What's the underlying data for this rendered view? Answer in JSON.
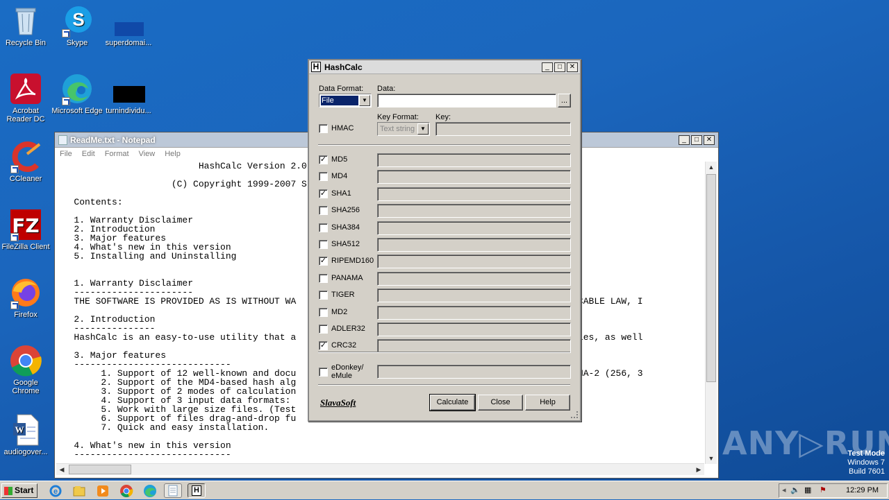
{
  "desktop": {
    "icons": [
      {
        "label": "Recycle Bin"
      },
      {
        "label": "Skype"
      },
      {
        "label": "superdomai..."
      },
      {
        "label": "Acrobat Reader DC"
      },
      {
        "label": "Microsoft Edge"
      },
      {
        "label": "turnindividu..."
      },
      {
        "label": "CCleaner"
      },
      {
        "label": "FileZilla Client"
      },
      {
        "label": "Firefox"
      },
      {
        "label": "Google Chrome"
      },
      {
        "label": "audiogover..."
      }
    ],
    "watermark": "ANY▷RUN",
    "test_mode": {
      "line1": "Test Mode",
      "line2": "Windows 7",
      "line3": "Build 7601"
    }
  },
  "notepad": {
    "title": "ReadMe.txt - Notepad",
    "menu": [
      "File",
      "Edit",
      "Format",
      "View",
      "Help"
    ],
    "lines": [
      "                          HashCalc Version 2.0",
      "",
      "                     (C) Copyright 1999-2007 S",
      "",
      "   Contents:",
      "",
      "   1. Warranty Disclaimer",
      "   2. Introduction",
      "   3. Major features",
      "   4. What's new in this version",
      "   5. Installing and Uninstalling",
      "",
      "",
      "   1. Warranty Disclaimer",
      "   ----------------------",
      "   THE SOFTWARE IS PROVIDED AS IS WITHOUT WA                                         ED BY APPLICABLE LAW, I",
      "",
      "   2. Introduction",
      "   ---------------",
      "   HashCalc is an easy-to-use utility that a                                         MACs for files, as well",
      "",
      "   3. Major features",
      "   -----------------------------",
      "        1. Support of 12 well-known and docu                                         5, SHA-1, SHA-2 (256, 3",
      "        2. Support of the MD4-based hash alg                                        ule, etc.);",
      "        3. Support of 2 modes of calculation",
      "        4. Support of 3 input data formats:",
      "        5. Work with large size files. (Test",
      "        6. Support of files drag-and-drop fu",
      "        7. Quick and easy installation.",
      "",
      "   4. What's new in this version",
      "   -----------------------------"
    ]
  },
  "hashcalc": {
    "title": "HashCalc",
    "data_format_label": "Data Format:",
    "data_format_value": "File",
    "data_label": "Data:",
    "data_value": "",
    "browse_label": "...",
    "hmac_label": "HMAC",
    "hmac_checked": false,
    "key_format_label": "Key Format:",
    "key_format_value": "Text string",
    "key_label": "Key:",
    "algorithms": [
      {
        "name": "MD5",
        "checked": true
      },
      {
        "name": "MD4",
        "checked": false
      },
      {
        "name": "SHA1",
        "checked": true
      },
      {
        "name": "SHA256",
        "checked": false
      },
      {
        "name": "SHA384",
        "checked": false
      },
      {
        "name": "SHA512",
        "checked": false
      },
      {
        "name": "RIPEMD160",
        "checked": true
      },
      {
        "name": "PANAMA",
        "checked": false
      },
      {
        "name": "TIGER",
        "checked": false
      },
      {
        "name": "MD2",
        "checked": false
      },
      {
        "name": "ADLER32",
        "checked": false
      },
      {
        "name": "CRC32",
        "checked": true
      }
    ],
    "edonkey_label_1": "eDonkey/",
    "edonkey_label_2": "eMule",
    "edonkey_checked": false,
    "brand": "SlavaSoft",
    "calculate_label": "Calculate",
    "close_label": "Close",
    "help_label": "Help"
  },
  "taskbar": {
    "start_label": "Start",
    "clock": "12:29 PM"
  }
}
